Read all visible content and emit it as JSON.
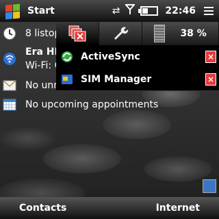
{
  "topbar": {
    "title": "Start",
    "clock": "22:46",
    "tray_icons": [
      "sync-arrows-icon",
      "signal-antenna-icon",
      "battery-icon",
      "menu-icon"
    ]
  },
  "today": {
    "date_text": "8 listop",
    "network_name": "Era HE",
    "wifi_text": "Wi-Fi: C",
    "messages_text": "No unr",
    "appointments_text": "No upcoming appointments"
  },
  "popup": {
    "battery_percent": "38 %",
    "tabs": [
      "tasks-tab",
      "settings-tab",
      "battery-tab"
    ],
    "processes": [
      {
        "name": "ActiveSync",
        "icon": "activesync-icon"
      },
      {
        "name": "SIM Manager",
        "icon": "sim-manager-icon"
      }
    ]
  },
  "softkeys": {
    "left": "Contacts",
    "right": "Internet"
  },
  "colors": {
    "close_red": "#e53a3a",
    "bar_dark": "#111111"
  }
}
